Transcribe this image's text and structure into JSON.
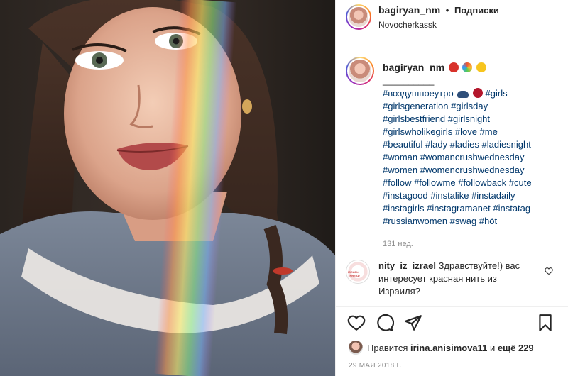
{
  "post": {
    "username": "bagiryan_nm",
    "dot": "•",
    "follow_label": "Подписки",
    "location": "Novocherkassk"
  },
  "caption": {
    "username": "bagiryan_nm",
    "underline": "__________",
    "line1_pre": "#воздушноеутро",
    "lines": [
      "#girlsgeneration #girlsday",
      "#girlsbestfriend #girlsnight",
      "#girlswholikegirls #love #me",
      "#beautiful #lady #ladies #ladiesnight",
      "#woman #womancrushwednesday",
      "#women #womencrushwednesday",
      "#follow #followme #followback #cute",
      "#instagood #instalike #instadaily",
      "#instagirls #instagramanet #instatag",
      "#russianwomen #swag #höt"
    ],
    "line1_post": "#girls",
    "time": "131 нед.",
    "emojis": [
      "ladybug-icon",
      "rainbow-icon",
      "sun-icon",
      "cloud-icon",
      "cherries-icon"
    ]
  },
  "comment": {
    "username": "nity_iz_izrael",
    "text": "Здравствуйте!) вас интересует красная нить из Израиля?",
    "avatar_text": "ISRAELI THREAD"
  },
  "likes": {
    "prefix": "Нравится",
    "user": "irina.anisimova11",
    "middle": "и",
    "suffix": "ещё 229"
  },
  "date": "29 МАЯ 2018 Г."
}
